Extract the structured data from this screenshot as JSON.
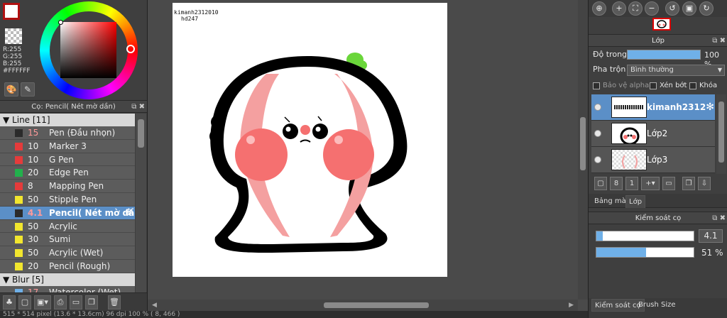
{
  "color": {
    "rgb_r": "R:255",
    "rgb_g": "G:255",
    "rgb_b": "B:255",
    "hex": "#FFFFFF",
    "foreground": "#ffffff",
    "accent": "#b01010"
  },
  "brush_panel": {
    "title": "Cọ: Pencil( Nét mờ dần)",
    "groups": [
      {
        "label": "Line [11]"
      },
      {
        "label": "Blur [5]"
      }
    ],
    "items": [
      {
        "num": "15",
        "name": "Pen (Đầu nhọn)",
        "color": "#2b2b2b"
      },
      {
        "num": "10",
        "name": "Marker 3",
        "color": "#e53b3b"
      },
      {
        "num": "10",
        "name": "G Pen",
        "color": "#e53b3b"
      },
      {
        "num": "20",
        "name": "Edge Pen",
        "color": "#22b14c"
      },
      {
        "num": "8",
        "name": "Mapping Pen",
        "color": "#e53b3b"
      },
      {
        "num": "50",
        "name": "Stipple Pen",
        "color": "#f2e62e"
      },
      {
        "num": "4.1",
        "name": "Pencil( Nét mờ dầ",
        "color": "#2b2b2b"
      },
      {
        "num": "50",
        "name": "Acrylic",
        "color": "#f2e62e"
      },
      {
        "num": "30",
        "name": "Sumi",
        "color": "#f2e62e"
      },
      {
        "num": "50",
        "name": "Acrylic (Wet)",
        "color": "#f2e62e"
      },
      {
        "num": "20",
        "name": "Pencil (Rough)",
        "color": "#f2e62e"
      }
    ],
    "blur_first": {
      "num": "17",
      "name": "Watercolor (Wet)"
    }
  },
  "canvas": {
    "watermark_line1": "kimanh2312010",
    "watermark_line2": "hd247"
  },
  "status": {
    "text": "515 * 514 pixel  (13.6 * 13.6cm)  96 dpi  100 %  ( 8, 466 )"
  },
  "layer_panel": {
    "title": "Lớp",
    "opacity_label": "Độ trong",
    "opacity_value": "100 %",
    "opacity_level": 1.0,
    "blend_label": "Pha trộn",
    "blend_value": "Bình thường",
    "protect_alpha": "Bảo vệ alpha",
    "clipping": "Xén bớt",
    "lock": "Khóa",
    "layers": [
      {
        "name": "kimanh2312",
        "selected": true
      },
      {
        "name": "Lớp2",
        "selected": false
      },
      {
        "name": "Lớp3",
        "selected": false
      }
    ],
    "tabs": [
      "Bảng màu",
      "Lớp"
    ]
  },
  "brush_control": {
    "title": "Kiểm soát cọ",
    "size_value": "4.1",
    "size_level": 0.041,
    "opacity_value": "51 %",
    "opacity_level": 0.51,
    "bottom_tabs": [
      "Kiểm soát cọ",
      "Brush Size"
    ]
  }
}
